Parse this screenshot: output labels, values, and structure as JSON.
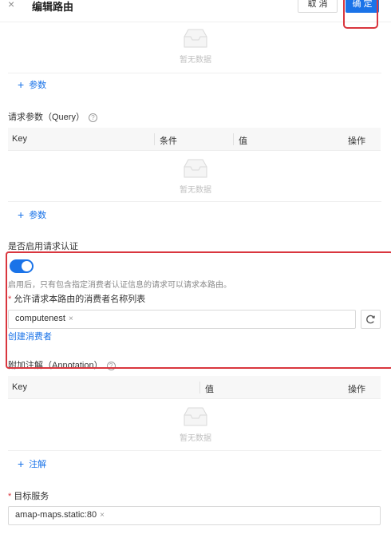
{
  "header": {
    "close_glyph": "×",
    "title": "编辑路由",
    "cancel_label": "取 消",
    "ok_label": "确 定"
  },
  "empty_text": "暂无数据",
  "params": {
    "add_label": "参数"
  },
  "query": {
    "title": "请求参数（Query）",
    "columns": [
      "Key",
      "条件",
      "值",
      "操作"
    ],
    "add_label": "参数"
  },
  "auth": {
    "title": "是否启用请求认证",
    "enabled": true,
    "description": "启用后，只有包含指定消费者认证信息的请求可以请求本路由。",
    "consumers_label": "允许请求本路由的消费者名称列表",
    "consumers": [
      "computenest"
    ],
    "create_consumer_label": "创建消费者"
  },
  "annotation": {
    "title": "附加注解（Annotation）",
    "columns": [
      "Key",
      "值",
      "操作"
    ],
    "add_label": "注解"
  },
  "target_service": {
    "label": "目标服务",
    "values": [
      "amap-maps.static:80"
    ]
  },
  "colors": {
    "primary": "#1a73e8",
    "highlight_border": "#d9363e"
  },
  "icons": [
    "close-icon",
    "empty-inbox-icon",
    "plus-icon",
    "help-circle-icon",
    "refresh-icon",
    "tag-close-icon"
  ]
}
